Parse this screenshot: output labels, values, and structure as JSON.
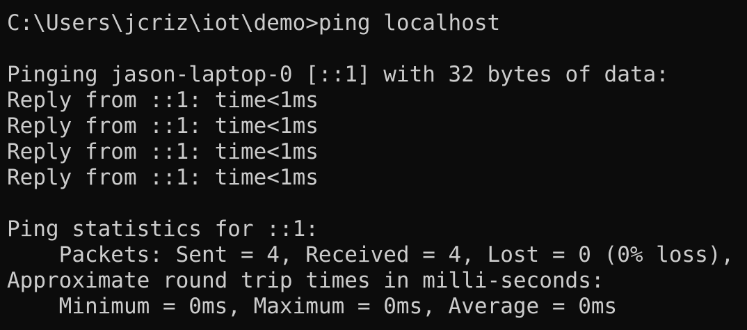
{
  "terminal": {
    "lines": [
      "C:\\Users\\jcriz\\iot\\demo>ping localhost",
      "",
      "Pinging jason-laptop-0 [::1] with 32 bytes of data:",
      "Reply from ::1: time<1ms",
      "Reply from ::1: time<1ms",
      "Reply from ::1: time<1ms",
      "Reply from ::1: time<1ms",
      "",
      "Ping statistics for ::1:",
      "    Packets: Sent = 4, Received = 4, Lost = 0 (0% loss),",
      "Approximate round trip times in milli-seconds:",
      "    Minimum = 0ms, Maximum = 0ms, Average = 0ms"
    ]
  },
  "colors": {
    "background": "#0c0c0c",
    "foreground": "#cccccc"
  }
}
